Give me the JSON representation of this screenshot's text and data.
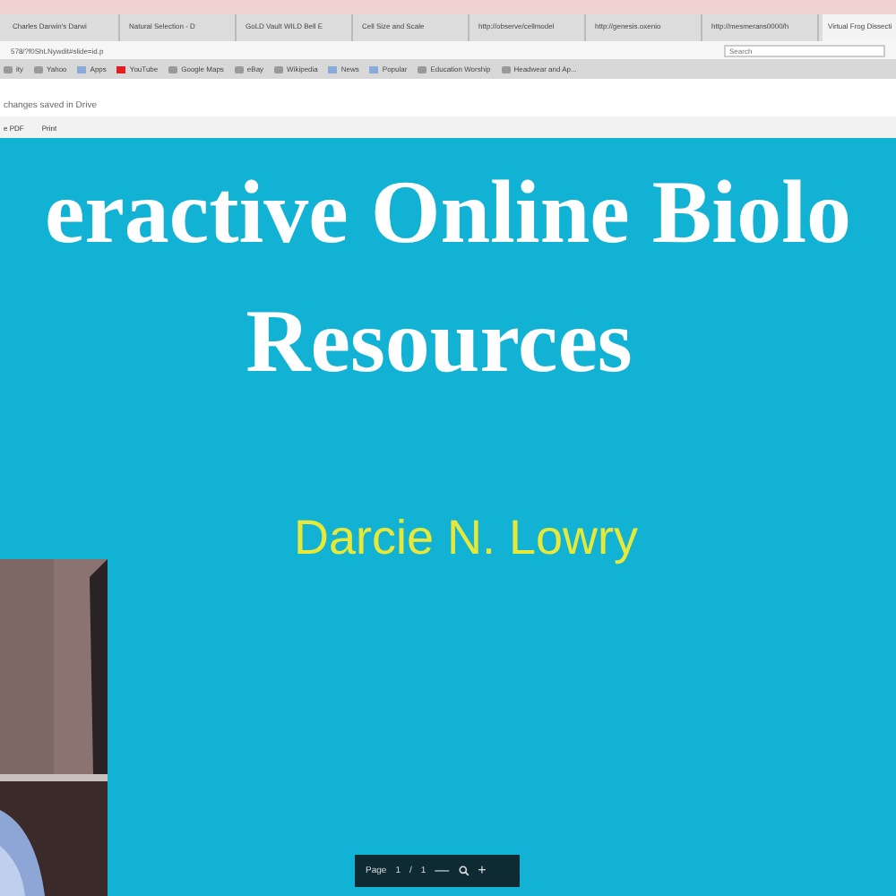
{
  "tabs": [
    {
      "label": "Charles Darwin's Darwi",
      "selected": false
    },
    {
      "label": "Natural Selection - D",
      "selected": false
    },
    {
      "label": "GoLD Vault WILD Bell E",
      "selected": false
    },
    {
      "label": "Cell Size and Scale",
      "selected": false
    },
    {
      "label": "http://observe/cellmodel",
      "selected": false
    },
    {
      "label": "http://genesis.oxenio",
      "selected": false
    },
    {
      "label": "http://mesmerans0000/h",
      "selected": false
    },
    {
      "label": "Virtual Frog Dissecti",
      "selected": true
    }
  ],
  "address": "578/?f0ShLNywdit#slide=id.p",
  "search": {
    "placeholder": "Search"
  },
  "bookmarks": [
    {
      "label": "ity",
      "kind": "page"
    },
    {
      "label": "Yahoo",
      "kind": "page"
    },
    {
      "label": "Apps",
      "kind": "folder"
    },
    {
      "label": "YouTube",
      "kind": "video"
    },
    {
      "label": "Google Maps",
      "kind": "page"
    },
    {
      "label": "eBay",
      "kind": "page"
    },
    {
      "label": "Wikipedia",
      "kind": "page"
    },
    {
      "label": "News",
      "kind": "folder"
    },
    {
      "label": "Popular",
      "kind": "folder"
    },
    {
      "label": "Education Worship",
      "kind": "page"
    },
    {
      "label": "Headwear and Ap...",
      "kind": "page"
    }
  ],
  "doc_status": "changes saved in Drive",
  "toolbar": [
    "e PDF",
    "Print"
  ],
  "slide": {
    "title_lines": [
      "eractive Online Biolo",
      "Resources"
    ],
    "author": "Darcie N. Lowry"
  },
  "pager": {
    "label": "Page",
    "current": "1",
    "separator": "/",
    "total": "1",
    "zoom_out": "—",
    "zoom_in": "+"
  }
}
